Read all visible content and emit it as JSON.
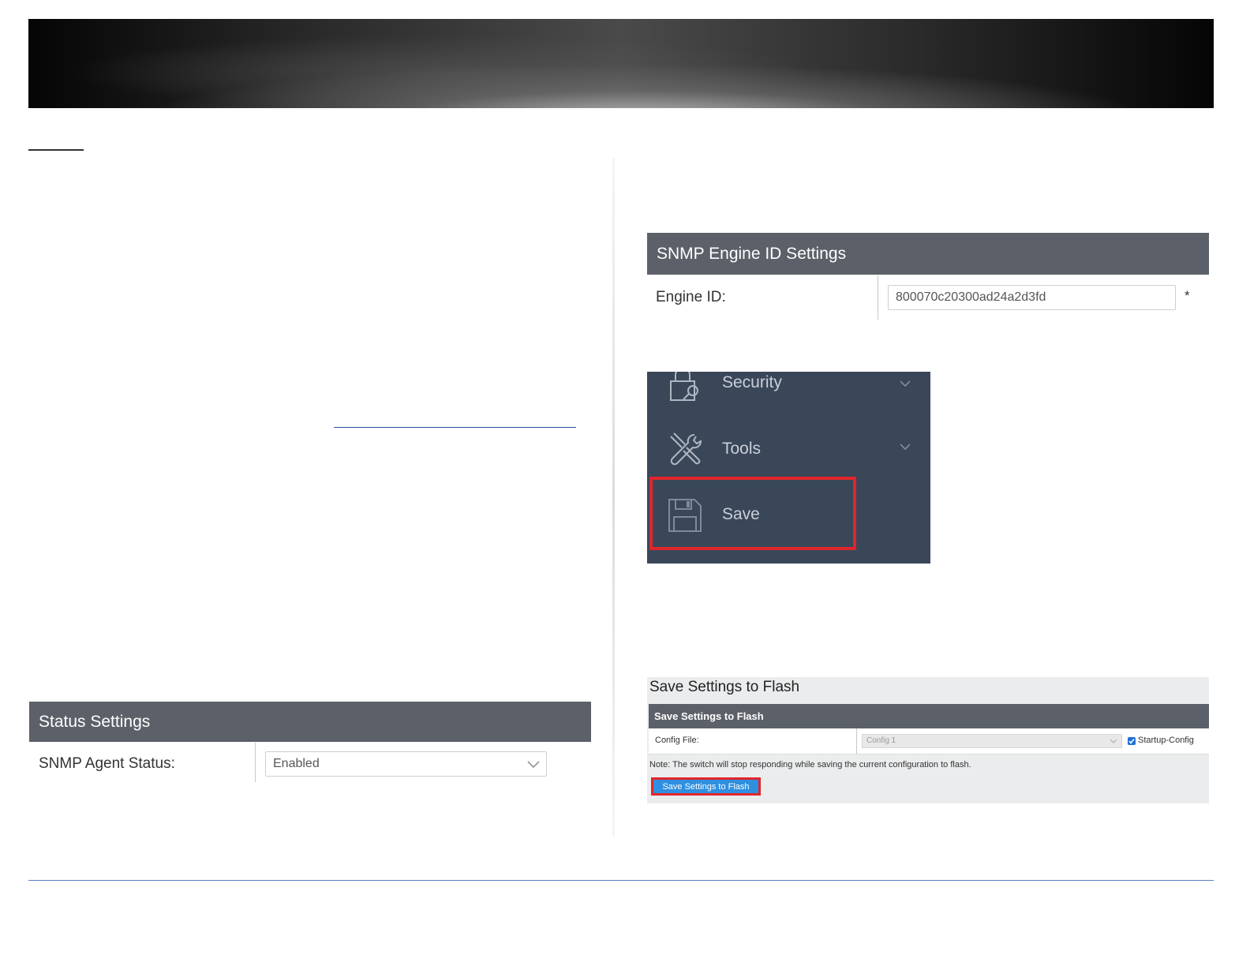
{
  "snmp_engine": {
    "header": "SNMP Engine ID Settings",
    "engine_id_label": "Engine ID:",
    "engine_id_value": "800070c20300ad24a2d3fd",
    "required_mark": "*"
  },
  "sidebar": {
    "items": [
      {
        "label": "Security",
        "icon": "lock-icon"
      },
      {
        "label": "Tools",
        "icon": "tools-icon"
      },
      {
        "label": "Save",
        "icon": "floppy-disk-icon"
      }
    ]
  },
  "status_settings": {
    "header": "Status Settings",
    "agent_status_label": "SNMP Agent Status:",
    "agent_status_value": "Enabled"
  },
  "save_flash": {
    "title": "Save Settings to Flash",
    "panel_header": "Save Settings to Flash",
    "config_file_label": "Config File:",
    "config_file_value": "Config 1",
    "startup_config_label": "Startup-Config",
    "startup_config_checked": true,
    "note": "Note: The switch will stop responding while saving the current configuration to flash.",
    "button_label": "Save Settings to Flash"
  },
  "colors": {
    "panel_header": "#5c6169",
    "sidebar_bg": "#3a4759",
    "highlight": "#e0262b",
    "button": "#2f8fe0"
  }
}
